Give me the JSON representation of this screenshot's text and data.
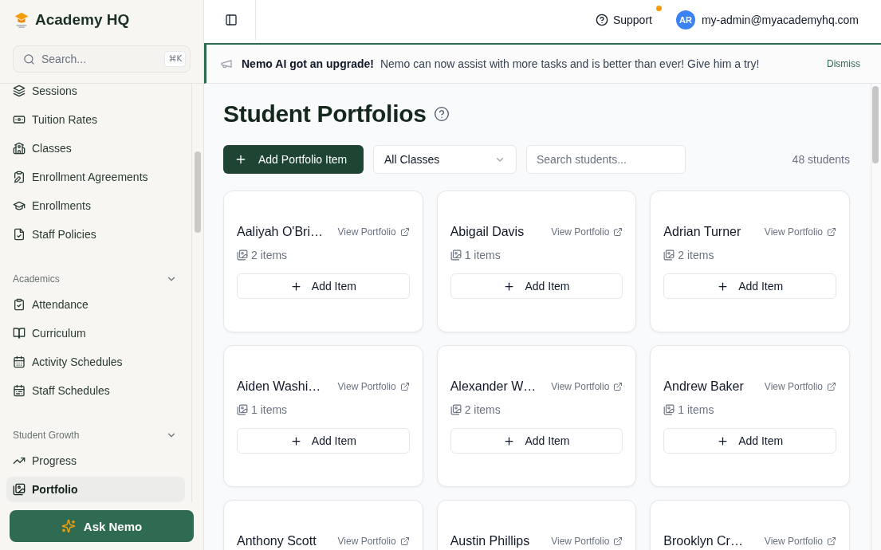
{
  "sidebar": {
    "brand": "Academy HQ",
    "search": {
      "placeholder": "Search...",
      "shortcut": "⌘K"
    },
    "groups": [
      {
        "items": [
          {
            "label": "Sessions",
            "selected": false
          },
          {
            "label": "Tuition Rates",
            "selected": false
          },
          {
            "label": "Classes",
            "selected": false
          },
          {
            "label": "Enrollment Agreements",
            "selected": false
          },
          {
            "label": "Enrollments",
            "selected": false
          },
          {
            "label": "Staff Policies",
            "selected": false
          }
        ]
      },
      {
        "title": "Academics",
        "expanded": true,
        "items": [
          {
            "label": "Attendance",
            "selected": false
          },
          {
            "label": "Curriculum",
            "selected": false
          },
          {
            "label": "Activity Schedules",
            "selected": false
          },
          {
            "label": "Staff Schedules",
            "selected": false
          }
        ]
      },
      {
        "title": "Student Growth",
        "expanded": true,
        "items": [
          {
            "label": "Progress",
            "selected": false
          },
          {
            "label": "Portfolio",
            "selected": true
          }
        ]
      }
    ],
    "ask_button": "Ask Nemo"
  },
  "topbar": {
    "support": {
      "label": "Support",
      "notification": true
    },
    "user": {
      "initials": "AR",
      "email": "my-admin@myacademyhq.com"
    }
  },
  "banner": {
    "title": "Nemo AI got an upgrade!",
    "message": "Nemo can now assist with more tasks and is better than ever! Give him a try!",
    "dismiss": "Dismiss"
  },
  "page": {
    "title": "Student Portfolios",
    "add_button": "Add Portfolio Item",
    "class_filter": {
      "value": "All Classes"
    },
    "search": {
      "placeholder": "Search students..."
    },
    "count": "48 students",
    "students": [
      {
        "name": "Aaliyah O'Bri…",
        "link": "View Portfolio",
        "items": "2 items",
        "add_button": "Add Item"
      },
      {
        "name": "Abigail Davis",
        "link": "View Portfolio",
        "items": "1 items",
        "add_button": "Add Item"
      },
      {
        "name": "Adrian Turner",
        "link": "View Portfolio",
        "items": "2 items",
        "add_button": "Add Item"
      },
      {
        "name": "Aiden Washi…",
        "link": "View Portfolio",
        "items": "1 items",
        "add_button": "Add Item"
      },
      {
        "name": "Alexander W…",
        "link": "View Portfolio",
        "items": "2 items",
        "add_button": "Add Item"
      },
      {
        "name": "Andrew Baker",
        "link": "View Portfolio",
        "items": "1 items",
        "add_button": "Add Item"
      },
      {
        "name": "Anthony Scott",
        "link": "View Portfolio"
      },
      {
        "name": "Austin Phillips",
        "link": "View Portfolio"
      },
      {
        "name": "Brooklyn Cr…",
        "link": "View Portfolio"
      }
    ]
  }
}
